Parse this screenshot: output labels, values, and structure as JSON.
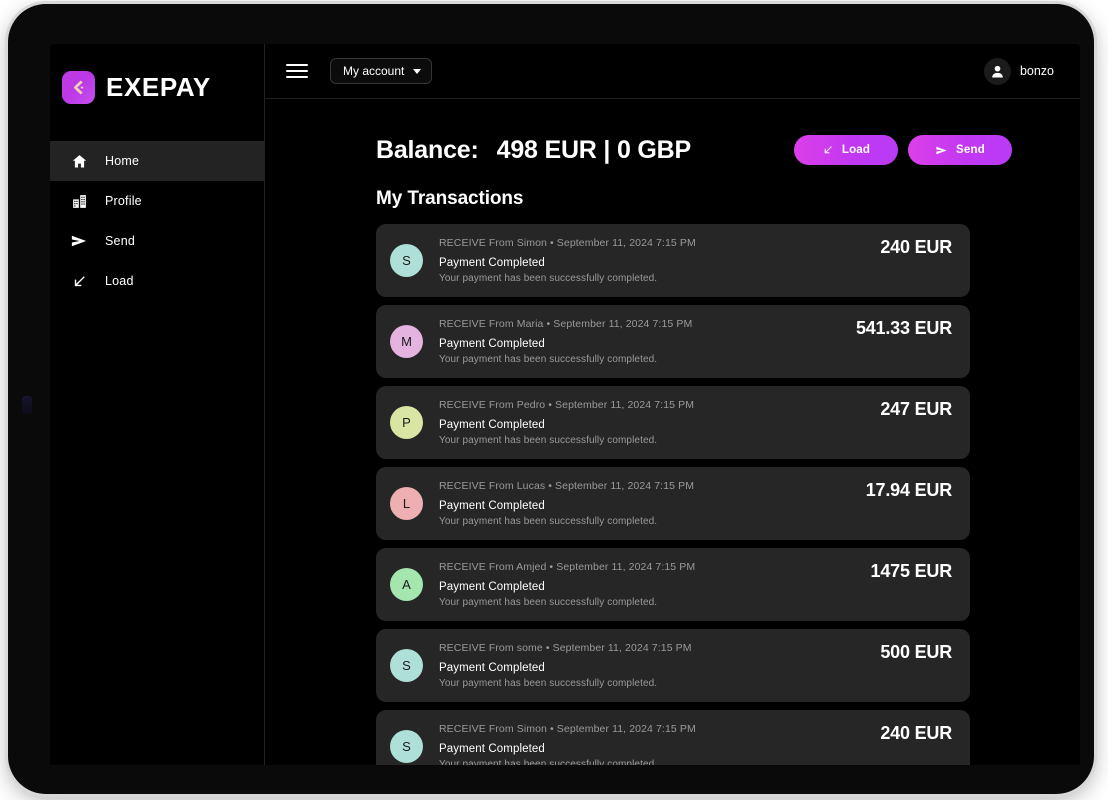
{
  "brand": {
    "name": "EXEPAY",
    "logo_icon": "exepay-arrow-logo",
    "logo_gradient_from": "#c23be0",
    "logo_gradient_to": "#c451ef",
    "logo_glyph_color": "#f7c9a8"
  },
  "sidebar": {
    "items": [
      {
        "label": "Home",
        "icon": "home-icon",
        "active": true
      },
      {
        "label": "Profile",
        "icon": "building-icon",
        "active": false
      },
      {
        "label": "Send",
        "icon": "send-arrow-icon",
        "active": false
      },
      {
        "label": "Load",
        "icon": "arrow-down-left-icon",
        "active": false
      }
    ]
  },
  "topbar": {
    "menu_icon": "hamburger-menu-icon",
    "account_select_label": "My account",
    "account_caret_icon": "chevron-down-icon",
    "user_avatar_icon": "person-icon",
    "user_name": "bonzo"
  },
  "main": {
    "balance_label": "Balance:",
    "balance_value": "498 EUR | 0 GBP",
    "section_title": "My Transactions",
    "buttons": [
      {
        "label": "Load",
        "icon": "arrow-down-left-icon"
      },
      {
        "label": "Send",
        "icon": "send-arrow-icon"
      }
    ],
    "accent_gradient_from": "#db3fe8",
    "accent_gradient_to": "#b93bf7"
  },
  "transactions": [
    {
      "initial": "S",
      "avatar_color": "#aee0d8",
      "meta": "RECEIVE From Simon • September 11, 2024 7:15 PM",
      "status": "Payment Completed",
      "description": "Your payment has been successfully completed.",
      "amount": "240 EUR"
    },
    {
      "initial": "M",
      "avatar_color": "#e5b3df",
      "meta": "RECEIVE From Maria • September 11, 2024 7:15 PM",
      "status": "Payment Completed",
      "description": "Your payment has been successfully completed.",
      "amount": "541.33 EUR"
    },
    {
      "initial": "P",
      "avatar_color": "#d9e6a3",
      "meta": "RECEIVE From Pedro • September 11, 2024 7:15 PM",
      "status": "Payment Completed",
      "description": "Your payment has been successfully completed.",
      "amount": "247 EUR"
    },
    {
      "initial": "L",
      "avatar_color": "#eeafb3",
      "meta": "RECEIVE From Lucas • September 11, 2024 7:15 PM",
      "status": "Payment Completed",
      "description": "Your payment has been successfully completed.",
      "amount": "17.94 EUR"
    },
    {
      "initial": "A",
      "avatar_color": "#a5e6ae",
      "meta": "RECEIVE From Amjed • September 11, 2024 7:15 PM",
      "status": "Payment Completed",
      "description": "Your payment has been successfully completed.",
      "amount": "1475 EUR"
    },
    {
      "initial": "S",
      "avatar_color": "#aee0d8",
      "meta": "RECEIVE From some • September 11, 2024 7:15 PM",
      "status": "Payment Completed",
      "description": "Your payment has been successfully completed.",
      "amount": "500 EUR"
    },
    {
      "initial": "S",
      "avatar_color": "#aee0d8",
      "meta": "RECEIVE From Simon • September 11, 2024 7:15 PM",
      "status": "Payment Completed",
      "description": "Your payment has been successfully completed.",
      "amount": "240 EUR"
    }
  ]
}
